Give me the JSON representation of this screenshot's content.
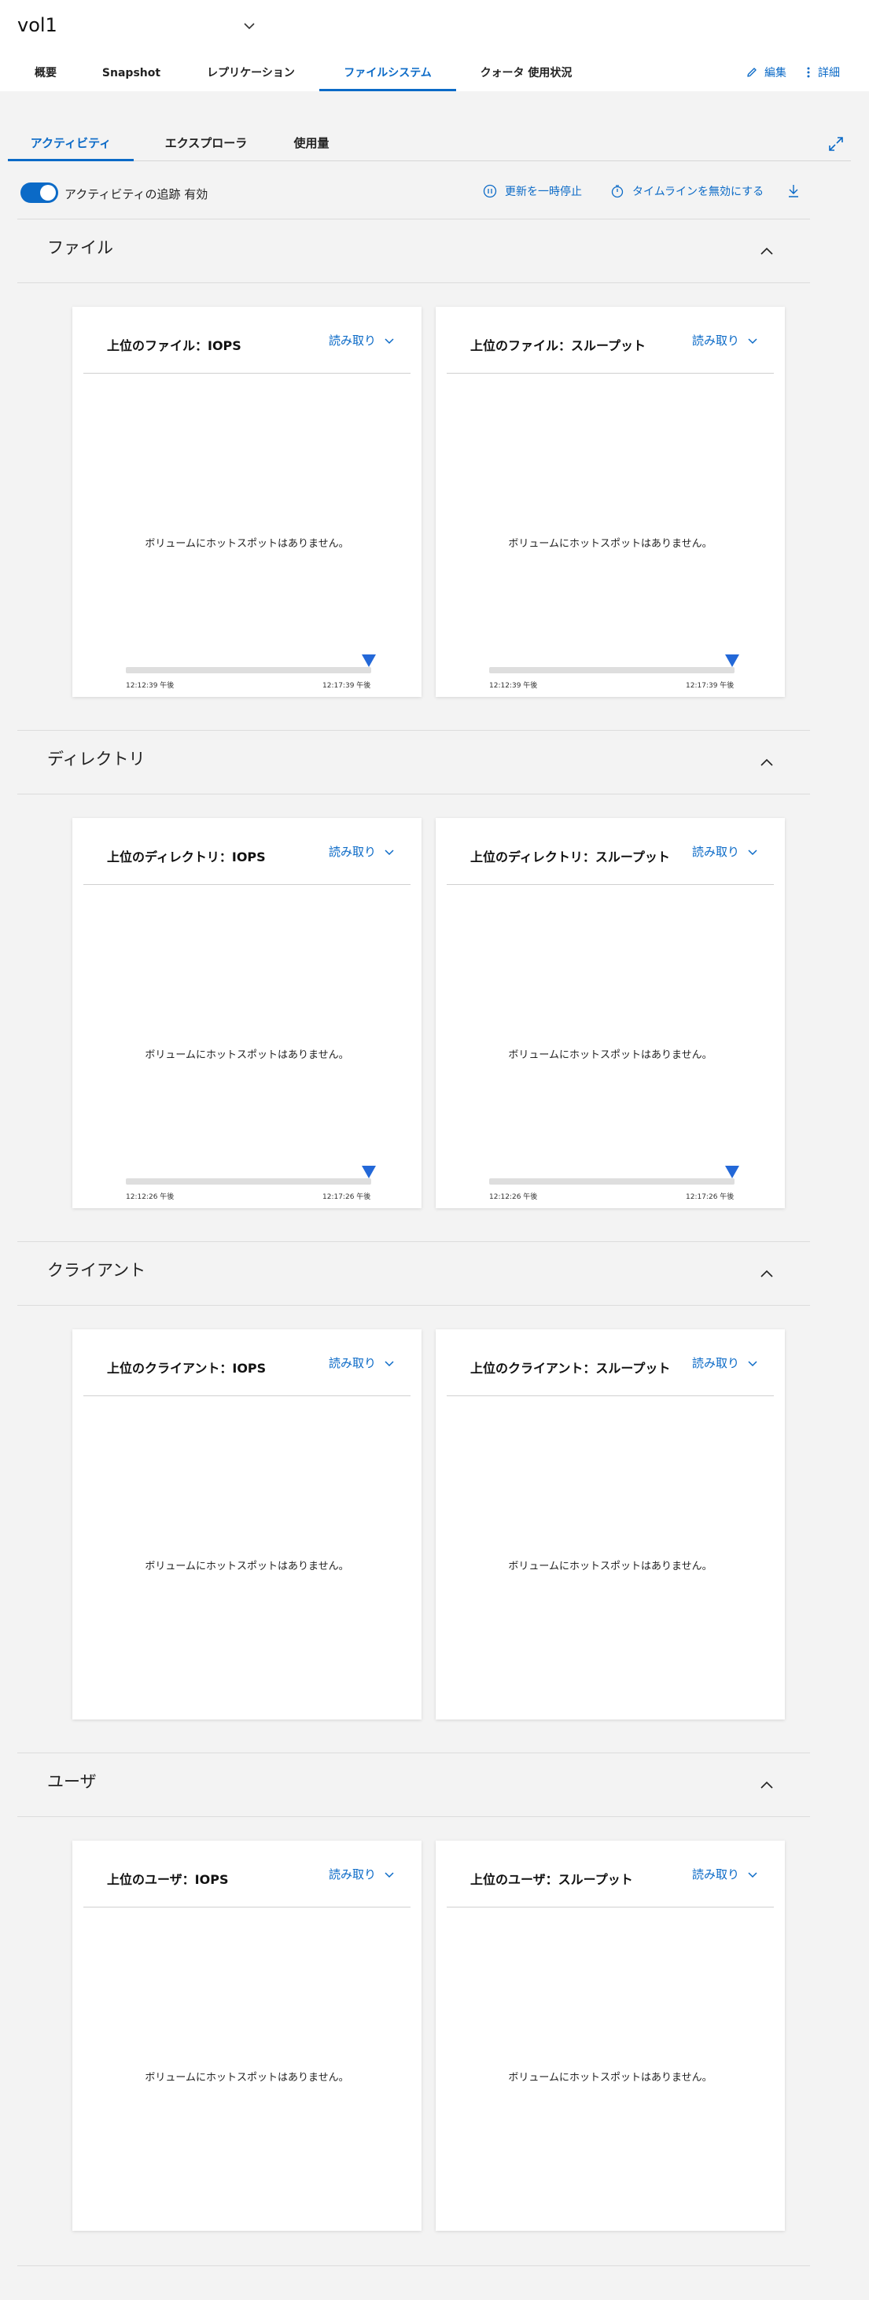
{
  "header": {
    "title": "vol1",
    "tabs": [
      "概要",
      "Snapshot",
      "レプリケーション",
      "ファイルシステム",
      "クォータ 使用状況"
    ],
    "active_tab": "ファイルシステム",
    "edit_label": "編集",
    "details_label": "詳細"
  },
  "subtabs": {
    "items": [
      "アクティビティ",
      "エクスプローラ",
      "使用量"
    ],
    "active": "アクティビティ"
  },
  "toolbar": {
    "toggle_label": "アクティビティの追跡 有効",
    "toggle_on": true,
    "pause_label": "更新を一時停止",
    "disable_timeline_label": "タイムラインを無効にする"
  },
  "sections": [
    {
      "title": "ファイル",
      "cards": [
        {
          "title": "上位のファイル：IOPS",
          "read_label": "読み取り",
          "empty": "ボリュームにホットスポットはありません。",
          "tl_start": "12:12:39 午後",
          "tl_end": "12:17:39 午後"
        },
        {
          "title": "上位のファイル：スループット",
          "read_label": "読み取り",
          "empty": "ボリュームにホットスポットはありません。",
          "tl_start": "12:12:39 午後",
          "tl_end": "12:17:39 午後"
        }
      ]
    },
    {
      "title": "ディレクトリ",
      "cards": [
        {
          "title": "上位のディレクトリ：IOPS",
          "read_label": "読み取り",
          "empty": "ボリュームにホットスポットはありません。",
          "tl_start": "12:12:26 午後",
          "tl_end": "12:17:26 午後"
        },
        {
          "title": "上位のディレクトリ：スループット",
          "read_label": "読み取り",
          "empty": "ボリュームにホットスポットはありません。",
          "tl_start": "12:12:26 午後",
          "tl_end": "12:17:26 午後"
        }
      ]
    },
    {
      "title": "クライアント",
      "cards": [
        {
          "title": "上位のクライアント：IOPS",
          "read_label": "読み取り",
          "empty": "ボリュームにホットスポットはありません。"
        },
        {
          "title": "上位のクライアント：スループット",
          "read_label": "読み取り",
          "empty": "ボリュームにホットスポットはありません。"
        }
      ]
    },
    {
      "title": "ユーザ",
      "cards": [
        {
          "title": "上位のユーザ：IOPS",
          "read_label": "読み取り",
          "empty": "ボリュームにホットスポットはありません。"
        },
        {
          "title": "上位のユーザ：スループット",
          "read_label": "読み取り",
          "empty": "ボリュームにホットスポットはありません。"
        }
      ]
    }
  ],
  "colors": {
    "accent": "#0b6ac7",
    "background": "#f3f3f3",
    "card": "#ffffff",
    "marker": "#2368d8"
  },
  "icons": {
    "title_dropdown": "chevron-down-icon",
    "edit": "pencil-icon",
    "details": "kebab-icon",
    "expand": "expand-icon",
    "pause": "pause-circle-icon",
    "timer": "stopwatch-icon",
    "download": "download-icon",
    "collapse": "chevron-up-icon",
    "read_dropdown": "chevron-down-icon"
  }
}
